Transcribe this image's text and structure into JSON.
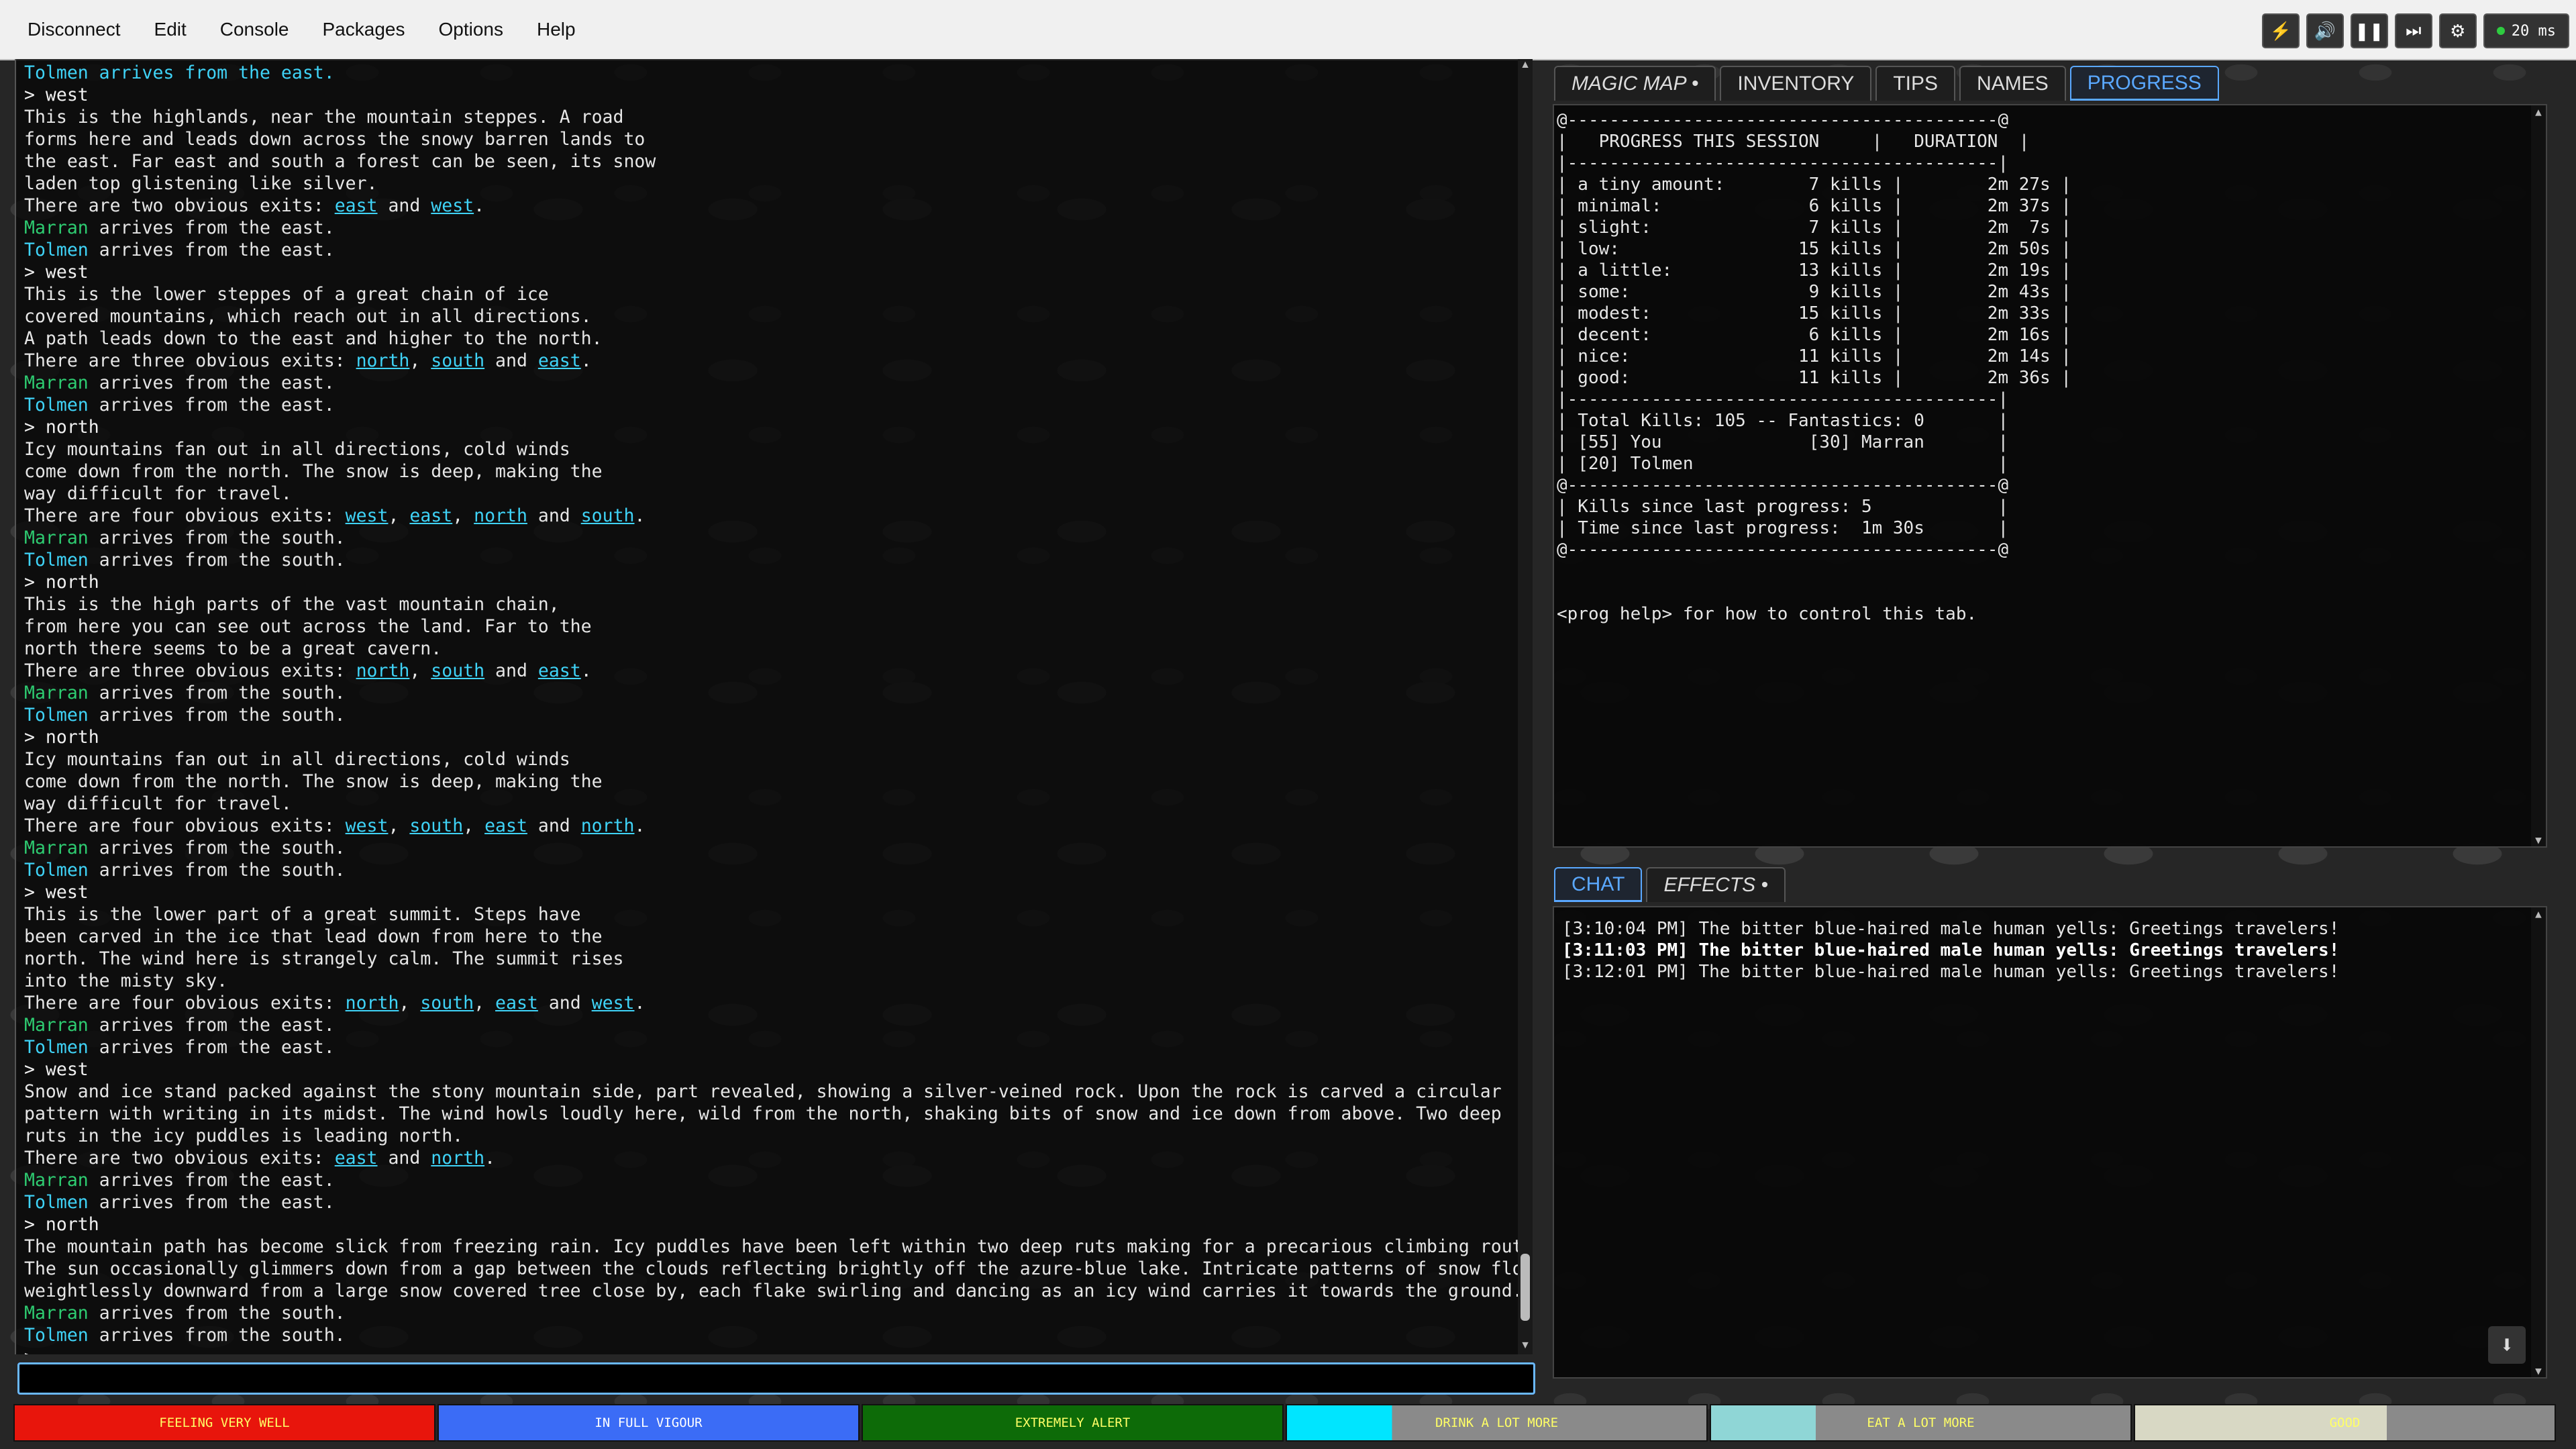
{
  "menu": [
    "Disconnect",
    "Edit",
    "Console",
    "Packages",
    "Options",
    "Help"
  ],
  "toolbar": {
    "ping": "20 ms",
    "icons": [
      "lightning-icon",
      "speaker-icon",
      "pause-icon",
      "skip-icon",
      "gear-icon"
    ]
  },
  "console_lines": [
    {
      "t": "npc",
      "text": "Tolmen arrives from the east."
    },
    {
      "t": "cmd",
      "text": "> west"
    },
    {
      "t": "plain",
      "text": "This is the highlands, near the mountain steppes. A road"
    },
    {
      "t": "plain",
      "text": "forms here and leads down across the snowy barren lands to"
    },
    {
      "t": "plain",
      "text": "the east. Far east and south a forest can be seen, its snow"
    },
    {
      "t": "plain",
      "text": "laden top glistening like silver."
    },
    {
      "t": "exits",
      "prefix": "There are two obvious exits: ",
      "exits": [
        "east",
        "west"
      ]
    },
    {
      "t": "npc",
      "name": "Marran",
      "rest": " arrives from the east."
    },
    {
      "t": "npc2",
      "name": "Tolmen",
      "rest": " arrives from the east."
    },
    {
      "t": "cmd",
      "text": "> west"
    },
    {
      "t": "plain",
      "text": "This is the lower steppes of a great chain of ice"
    },
    {
      "t": "plain",
      "text": "covered mountains, which reach out in all directions."
    },
    {
      "t": "plain",
      "text": "A path leads down to the east and higher to the north."
    },
    {
      "t": "exits",
      "prefix": "There are three obvious exits: ",
      "exits": [
        "north",
        "south",
        "east"
      ]
    },
    {
      "t": "npc",
      "name": "Marran",
      "rest": " arrives from the east."
    },
    {
      "t": "npc2",
      "name": "Tolmen",
      "rest": " arrives from the east."
    },
    {
      "t": "cmd",
      "text": "> north"
    },
    {
      "t": "plain",
      "text": "Icy mountains fan out in all directions, cold winds"
    },
    {
      "t": "plain",
      "text": "come down from the north. The snow is deep, making the"
    },
    {
      "t": "plain",
      "text": "way difficult for travel."
    },
    {
      "t": "exits",
      "prefix": "There are four obvious exits: ",
      "exits": [
        "west",
        "east",
        "north",
        "south"
      ]
    },
    {
      "t": "npc",
      "name": "Marran",
      "rest": " arrives from the south."
    },
    {
      "t": "npc2",
      "name": "Tolmen",
      "rest": " arrives from the south."
    },
    {
      "t": "cmd",
      "text": "> north"
    },
    {
      "t": "plain",
      "text": "This is the high parts of the vast mountain chain,"
    },
    {
      "t": "plain",
      "text": "from here you can see out across the land. Far to the"
    },
    {
      "t": "plain",
      "text": "north there seems to be a great cavern."
    },
    {
      "t": "exits",
      "prefix": "There are three obvious exits: ",
      "exits": [
        "north",
        "south",
        "east"
      ]
    },
    {
      "t": "npc",
      "name": "Marran",
      "rest": " arrives from the south."
    },
    {
      "t": "npc2",
      "name": "Tolmen",
      "rest": " arrives from the south."
    },
    {
      "t": "cmd",
      "text": "> north"
    },
    {
      "t": "plain",
      "text": "Icy mountains fan out in all directions, cold winds"
    },
    {
      "t": "plain",
      "text": "come down from the north. The snow is deep, making the"
    },
    {
      "t": "plain",
      "text": "way difficult for travel."
    },
    {
      "t": "exits",
      "prefix": "There are four obvious exits: ",
      "exits": [
        "west",
        "south",
        "east",
        "north"
      ]
    },
    {
      "t": "npc",
      "name": "Marran",
      "rest": " arrives from the south."
    },
    {
      "t": "npc2",
      "name": "Tolmen",
      "rest": " arrives from the south."
    },
    {
      "t": "cmd",
      "text": "> west"
    },
    {
      "t": "plain",
      "text": "This is the lower part of a great summit. Steps have"
    },
    {
      "t": "plain",
      "text": "been carved in the ice that lead down from here to the"
    },
    {
      "t": "plain",
      "text": "north. The wind here is strangely calm. The summit rises"
    },
    {
      "t": "plain",
      "text": "into the misty sky."
    },
    {
      "t": "exits",
      "prefix": "There are four obvious exits: ",
      "exits": [
        "north",
        "south",
        "east",
        "west"
      ]
    },
    {
      "t": "npc",
      "name": "Marran",
      "rest": " arrives from the east."
    },
    {
      "t": "npc2",
      "name": "Tolmen",
      "rest": " arrives from the east."
    },
    {
      "t": "cmd",
      "text": "> west"
    },
    {
      "t": "plain",
      "text": "Snow and ice stand packed against the stony mountain side, part revealed, showing a silver-veined rock. Upon the rock is carved a circular"
    },
    {
      "t": "plain",
      "text": "pattern with writing in its midst. The wind howls loudly here, wild from the north, shaking bits of snow and ice down from above. Two deep"
    },
    {
      "t": "plain",
      "text": "ruts in the icy puddles is leading north."
    },
    {
      "t": "exits",
      "prefix": "There are two obvious exits: ",
      "exits": [
        "east",
        "north"
      ]
    },
    {
      "t": "npc",
      "name": "Marran",
      "rest": " arrives from the east."
    },
    {
      "t": "npc2",
      "name": "Tolmen",
      "rest": " arrives from the east."
    },
    {
      "t": "cmd",
      "text": "> north"
    },
    {
      "t": "plain",
      "text": "The mountain path has become slick from freezing rain. Icy puddles have been left within two deep ruts making for a precarious climbing route."
    },
    {
      "t": "plain",
      "text": "The sun occasionally glimmers down from a gap between the clouds reflecting brightly off the azure-blue lake. Intricate patterns of snow float"
    },
    {
      "t": "plain",
      "text": "weightlessly downward from a large snow covered tree close by, each flake swirling and dancing as an icy wind carries it towards the ground."
    },
    {
      "t": "npc",
      "name": "Marran",
      "rest": " arrives from the south."
    },
    {
      "t": "npc2",
      "name": "Tolmen",
      "rest": " arrives from the south."
    },
    {
      "t": "cmd",
      "text": ">"
    }
  ],
  "top_tabs": [
    {
      "label": "MAGIC MAP •",
      "italic": true,
      "active": false
    },
    {
      "label": "INVENTORY",
      "italic": false,
      "active": false
    },
    {
      "label": "TIPS",
      "italic": false,
      "active": false
    },
    {
      "label": "NAMES",
      "italic": false,
      "active": false
    },
    {
      "label": "PROGRESS",
      "italic": false,
      "active": true
    }
  ],
  "progress_text": "@-----------------------------------------@\n|   PROGRESS THIS SESSION     |   DURATION  |\n|-----------------------------------------|\n| a tiny amount:        7 kills |        2m 27s |\n| minimal:              6 kills |        2m 37s |\n| slight:               7 kills |        2m  7s |\n| low:                 15 kills |        2m 50s |\n| a little:            13 kills |        2m 19s |\n| some:                 9 kills |        2m 43s |\n| modest:              15 kills |        2m 33s |\n| decent:               6 kills |        2m 16s |\n| nice:                11 kills |        2m 14s |\n| good:                11 kills |        2m 36s |\n|-----------------------------------------|\n| Total Kills: 105 -- Fantastics: 0       |\n| [55] You              [30] Marran       |\n| [20] Tolmen                             |\n@-----------------------------------------@\n| Kills since last progress: 5            |\n| Time since last progress:  1m 30s       |\n@-----------------------------------------@\n\n\n<prog help> for how to control this tab.",
  "bottom_tabs": [
    {
      "label": "CHAT",
      "italic": false,
      "active": true
    },
    {
      "label": "EFFECTS •",
      "italic": true,
      "active": false
    }
  ],
  "chat": [
    {
      "text": "[3:10:04 PM] The bitter blue-haired male human yells: Greetings travelers!",
      "bold": false
    },
    {
      "text": "[3:11:03 PM] The bitter blue-haired male human yells: Greetings travelers!",
      "bold": true
    },
    {
      "text": "[3:12:01 PM] The bitter blue-haired male human yells: Greetings travelers!",
      "bold": false
    }
  ],
  "status": [
    {
      "label": "FEELING VERY WELL",
      "color": "#e8150c",
      "fill": 1.0,
      "textcolor": "#ffff66"
    },
    {
      "label": "IN FULL VIGOUR",
      "color": "#3b6cf6",
      "fill": 1.0,
      "textcolor": "#ffffff"
    },
    {
      "label": "EXTREMELY ALERT",
      "color": "#0d6b08",
      "fill": 1.0,
      "textcolor": "#ffff66"
    },
    {
      "label": "DRINK A LOT MORE",
      "color": "#00e5ff",
      "fill": 0.25,
      "textcolor": "#ffff66"
    },
    {
      "label": "EAT A LOT MORE",
      "color": "#8fd6d6",
      "fill": 0.25,
      "textcolor": "#ffff66"
    },
    {
      "label": "GOOD",
      "color": "#d8d8c4",
      "fill": 0.6,
      "textcolor": "#ffff66"
    }
  ]
}
